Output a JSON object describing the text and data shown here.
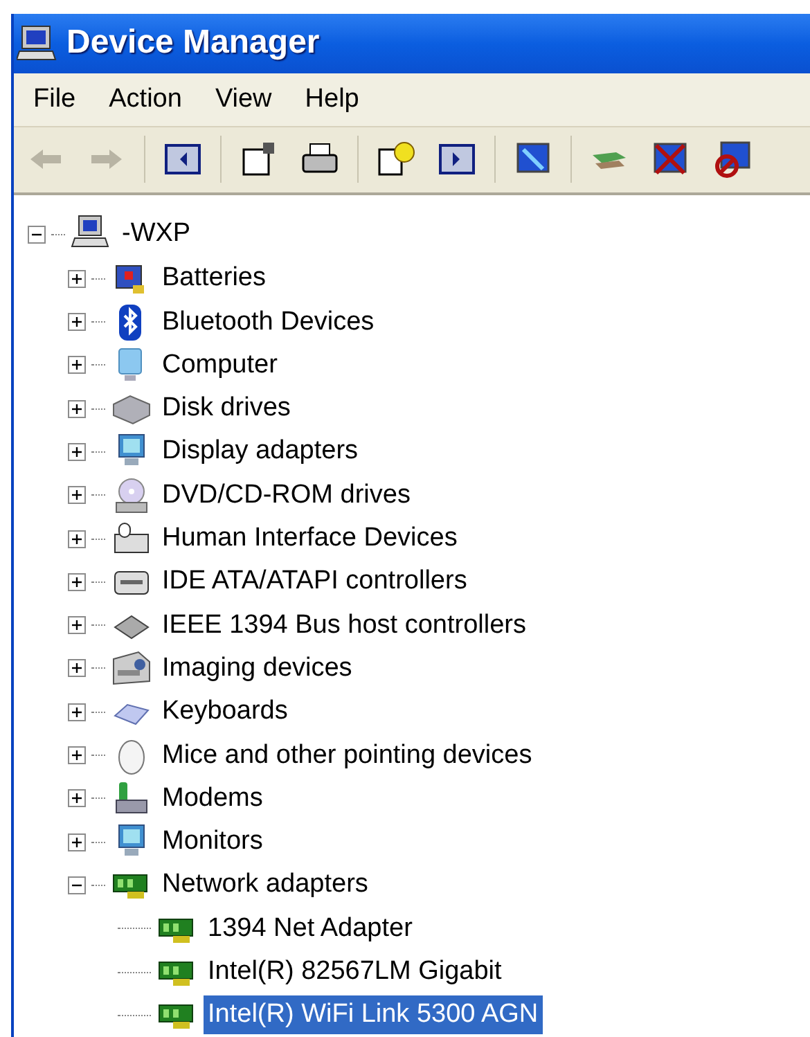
{
  "window": {
    "title": "Device Manager"
  },
  "menu": [
    "File",
    "Action",
    "View",
    "Help"
  ],
  "toolbar": [
    {
      "disabled": true
    },
    {
      "disabled": true
    },
    {
      "disabled": false
    },
    {
      "disabled": false
    },
    {
      "disabled": false
    },
    {
      "disabled": false
    },
    {
      "disabled": false
    },
    {
      "disabled": false
    },
    {
      "disabled": false
    },
    {
      "disabled": false
    },
    {
      "disabled": false
    }
  ],
  "tree": {
    "label": "-WXP",
    "expanded": true,
    "selected": false,
    "children": [
      {
        "label": "Batteries",
        "expanded": false,
        "selected": false
      },
      {
        "label": "Bluetooth Devices",
        "expanded": false,
        "selected": false
      },
      {
        "label": "Computer",
        "expanded": false,
        "selected": false
      },
      {
        "label": "Disk drives",
        "expanded": false,
        "selected": false
      },
      {
        "label": "Display adapters",
        "expanded": false,
        "selected": false
      },
      {
        "label": "DVD/CD-ROM drives",
        "expanded": false,
        "selected": false
      },
      {
        "label": "Human Interface Devices",
        "expanded": false,
        "selected": false
      },
      {
        "label": "IDE ATA/ATAPI controllers",
        "expanded": false,
        "selected": false
      },
      {
        "label": "IEEE 1394 Bus host controllers",
        "expanded": false,
        "selected": false
      },
      {
        "label": "Imaging devices",
        "expanded": false,
        "selected": false
      },
      {
        "label": "Keyboards",
        "expanded": false,
        "selected": false
      },
      {
        "label": "Mice and other pointing devices",
        "expanded": false,
        "selected": false
      },
      {
        "label": "Modems",
        "expanded": false,
        "selected": false
      },
      {
        "label": "Monitors",
        "expanded": false,
        "selected": false
      },
      {
        "label": "Network adapters",
        "expanded": true,
        "selected": false,
        "children": [
          {
            "label": "1394 Net Adapter",
            "selected": false
          },
          {
            "label": "Intel(R) 82567LM Gigabit",
            "selected": false
          },
          {
            "label": "Intel(R) WiFi Link 5300 AGN",
            "selected": true
          }
        ]
      }
    ]
  }
}
